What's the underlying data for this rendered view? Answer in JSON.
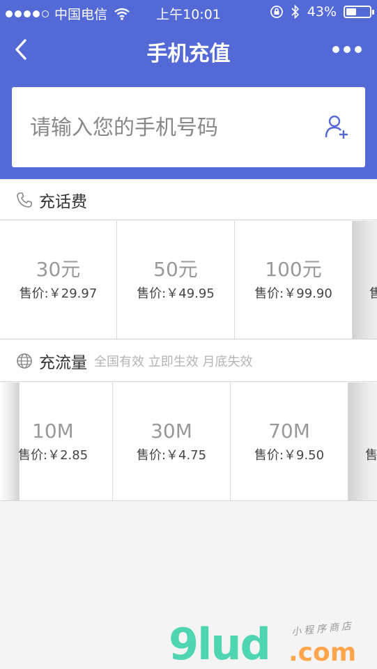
{
  "status_bar": {
    "carrier": "中国电信",
    "time": "上午10:01",
    "battery_percent": "43%",
    "battery_level": 0.43
  },
  "nav": {
    "title": "手机充值",
    "back_icon": "chevron-left-icon",
    "more_icon": "more-dots-icon"
  },
  "phone_input": {
    "placeholder": "请输入您的手机号码",
    "value": "",
    "contact_icon": "add-contact-icon"
  },
  "call_section": {
    "label": "充话费",
    "icon": "phone-icon",
    "items": [
      {
        "amount": "30元",
        "price": "售价:￥29.97"
      },
      {
        "amount": "50元",
        "price": "售价:￥49.95"
      },
      {
        "amount": "100元",
        "price": "售价:￥99.90"
      },
      {
        "amount": "",
        "price": "售"
      }
    ]
  },
  "data_section": {
    "label": "充流量",
    "note": "全国有效 立即生效 月底失效",
    "icon": "globe-icon",
    "items": [
      {
        "amount": "10M",
        "price": "售价:￥2.85"
      },
      {
        "amount": "30M",
        "price": "售价:￥4.75"
      },
      {
        "amount": "70M",
        "price": "售价:￥9.50"
      },
      {
        "amount": "",
        "price": "售"
      }
    ]
  },
  "watermark": {
    "logo": "9lud",
    "domain": ".com",
    "tagline": "小程序商店"
  },
  "colors": {
    "primary": "#5369d6",
    "background": "#f4f4f4",
    "watermark_green": "#4fd6b0",
    "watermark_orange": "#ffa64d"
  }
}
